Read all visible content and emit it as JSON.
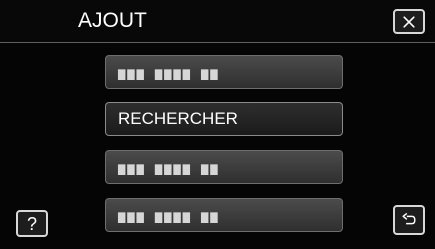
{
  "header": {
    "title": "AJOUT"
  },
  "buttons": {
    "close_icon": "close-icon",
    "help_label": "?",
    "help_icon": "question-icon",
    "return_icon": "return-icon"
  },
  "menu": {
    "items": [
      {
        "label": "▆▆▆ ▆▆▆▆ ▆▆"
      },
      {
        "label": "RECHERCHER"
      },
      {
        "label": "▆▆▆ ▆▆▆▆ ▆▆"
      },
      {
        "label": "▆▆▆ ▆▆▆▆ ▆▆"
      }
    ]
  },
  "colors": {
    "background": "#050505",
    "button_border": "#d8d8d8",
    "menu_button": "#3a3a3a"
  }
}
